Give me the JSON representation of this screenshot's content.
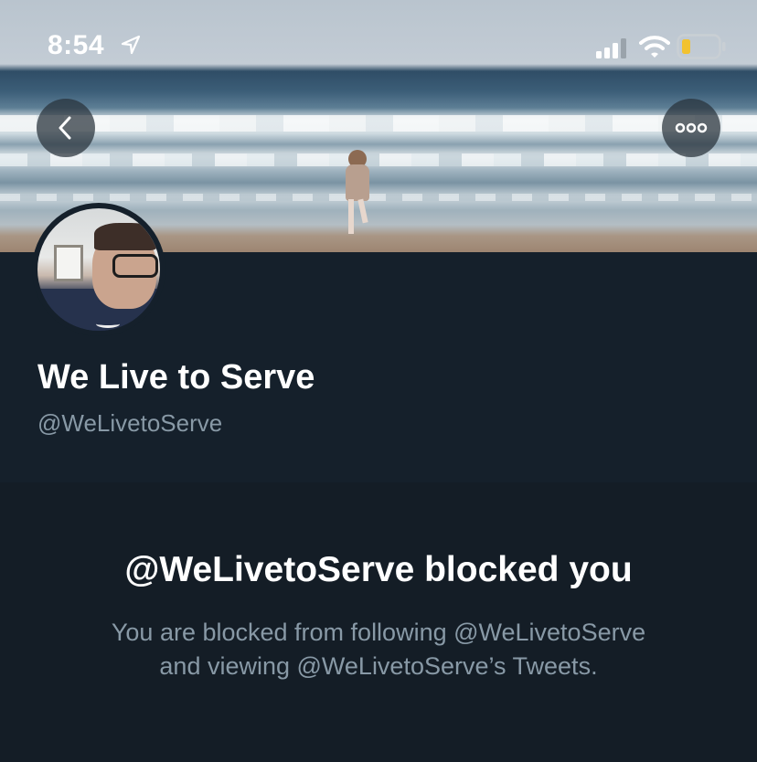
{
  "status_bar": {
    "time": "8:54",
    "icons": [
      "location-arrow-icon",
      "cellular-signal-icon",
      "wifi-icon",
      "battery-low-icon"
    ],
    "battery_color": "#f2c230"
  },
  "header": {
    "back_icon": "chevron-left-icon",
    "more_icon": "more-horizontal-icon"
  },
  "profile": {
    "display_name": "We Live to Serve",
    "handle": "@WeLivetoServe"
  },
  "blocked": {
    "title": "@WeLivetoServe blocked you",
    "message_line1": "You are blocked from following @WeLivetoServe",
    "message_line2": "and viewing @WeLivetoServe’s Tweets."
  },
  "colors": {
    "background": "#141d26",
    "profile_background": "#15202b",
    "secondary_text": "#8899a6",
    "primary_text": "#ffffff"
  }
}
